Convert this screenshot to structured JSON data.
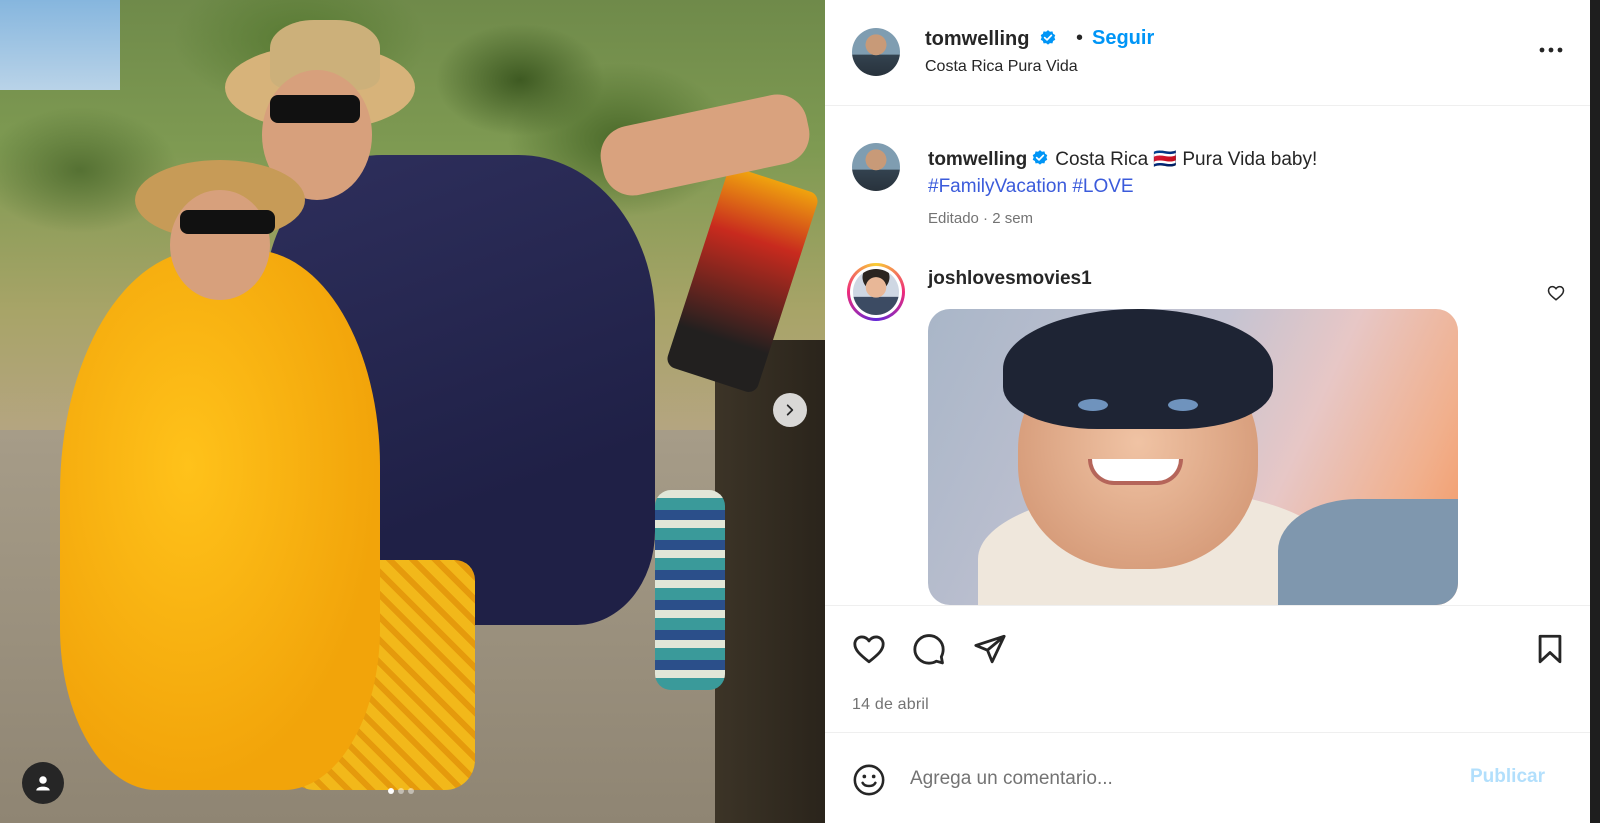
{
  "header": {
    "username": "tomwelling",
    "separator": "•",
    "follow_label": "Seguir",
    "location": "Costa Rica Pura Vida"
  },
  "caption": {
    "username": "tomwelling",
    "text": "Costa Rica 🇨🇷 Pura Vida baby!",
    "hashtags": [
      "#FamilyVacation",
      "#LOVE"
    ],
    "meta": "Editado · 2 sem"
  },
  "comment": {
    "username": "joshlovesmovies1"
  },
  "actions": {
    "date": "14 de abril"
  },
  "comment_bar": {
    "placeholder": "Agrega un comentario...",
    "publish_label": "Publicar"
  },
  "carousel": {
    "slide_count": 3,
    "active_slide": 1
  },
  "icons": {
    "verified": "verified-badge-icon",
    "more": "more-options-icon",
    "like": "heart-icon",
    "comment": "comment-bubble-icon",
    "share": "paper-plane-icon",
    "save": "bookmark-icon",
    "emoji": "smiley-icon",
    "next": "chevron-right-icon",
    "user_tag": "person-icon"
  },
  "colors": {
    "accent": "#0095f6",
    "hashtag": "#3b5bdb",
    "publish_disabled": "#b2dffc",
    "verified": "#0095f6"
  }
}
